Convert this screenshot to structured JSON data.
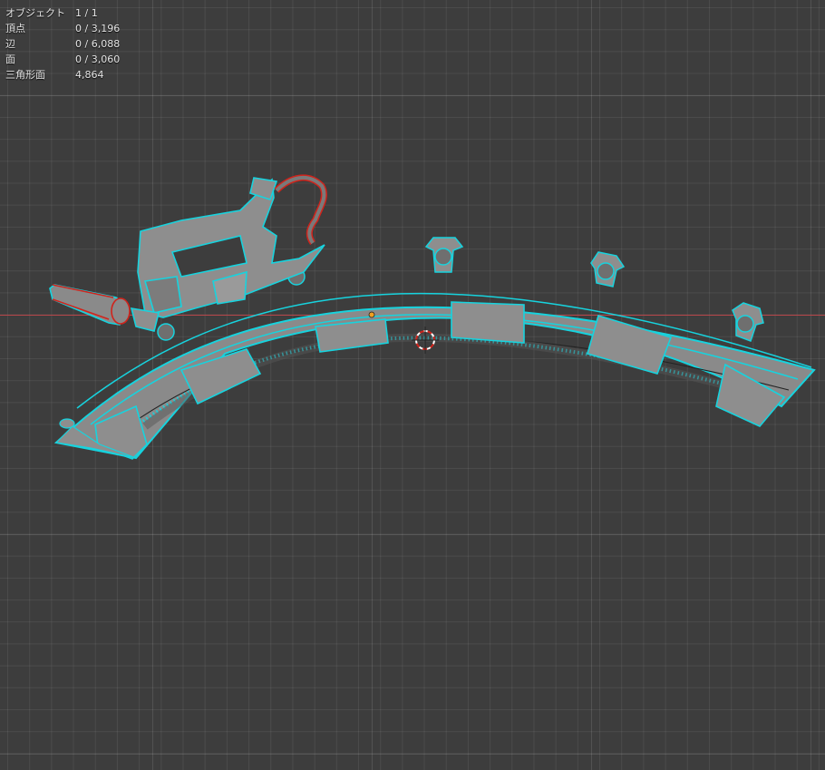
{
  "stats": [
    {
      "label": "オブジェクト",
      "value": "1 / 1"
    },
    {
      "label": "頂点",
      "value": "0 / 3,196"
    },
    {
      "label": "辺",
      "value": "0 / 6,088"
    },
    {
      "label": "面",
      "value": "0 / 3,060"
    },
    {
      "label": "三角形面",
      "value": "4,864"
    }
  ],
  "colors": {
    "background": "#3d3d3d",
    "mesh_fill": "#8e8e8e",
    "selection_outline": "#17d3de",
    "seam_edge": "#d0241c",
    "x_axis": "#b8464a",
    "origin": "#f0a020"
  }
}
